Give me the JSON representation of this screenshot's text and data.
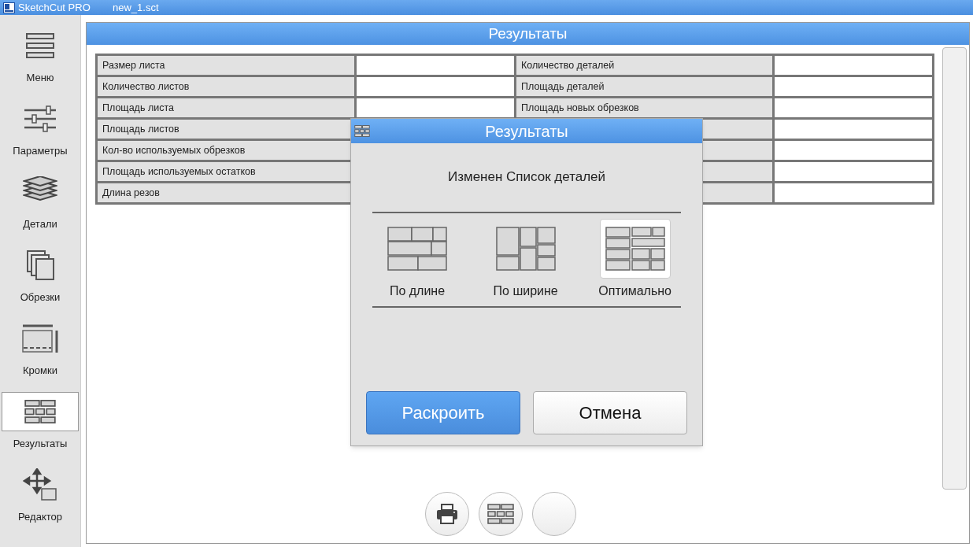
{
  "app_bar": {
    "app_name": "SketchCut PRO",
    "file_name": "new_1.sct"
  },
  "sidebar": {
    "items": [
      {
        "kind": "menu",
        "label": "Меню",
        "selected": false
      },
      {
        "kind": "params",
        "label": "Параметры",
        "selected": false
      },
      {
        "kind": "parts",
        "label": "Детали",
        "selected": false
      },
      {
        "kind": "offcuts",
        "label": "Обрезки",
        "selected": false
      },
      {
        "kind": "edges",
        "label": "Кромки",
        "selected": false
      },
      {
        "kind": "results",
        "label": "Результаты",
        "selected": true
      },
      {
        "kind": "editor",
        "label": "Редактор",
        "selected": false
      }
    ]
  },
  "panel": {
    "title": "Результаты"
  },
  "table": {
    "left_labels": [
      "Размер листа",
      "Количество листов",
      "Площадь листа",
      "Площадь листов",
      "Кол-во используемых обрезков",
      "Площадь используемых остатков",
      "Длина резов"
    ],
    "right_labels": [
      "Количество деталей",
      "Площадь деталей",
      "Площадь новых обрезков"
    ]
  },
  "dialog": {
    "title": "Результаты",
    "message": "Изменен Список деталей",
    "options": [
      {
        "kind": "length",
        "label": "По длине",
        "selected": false
      },
      {
        "kind": "width",
        "label": "По ширине",
        "selected": false
      },
      {
        "kind": "optimal",
        "label": "Оптимально",
        "selected": true
      }
    ],
    "buttons": [
      {
        "kind": "primary",
        "label": "Раскроить"
      },
      {
        "kind": "secondary",
        "label": "Отмена"
      }
    ]
  },
  "bottom_buttons": [
    {
      "kind": "print"
    },
    {
      "kind": "layout"
    },
    {
      "kind": "empty"
    }
  ]
}
